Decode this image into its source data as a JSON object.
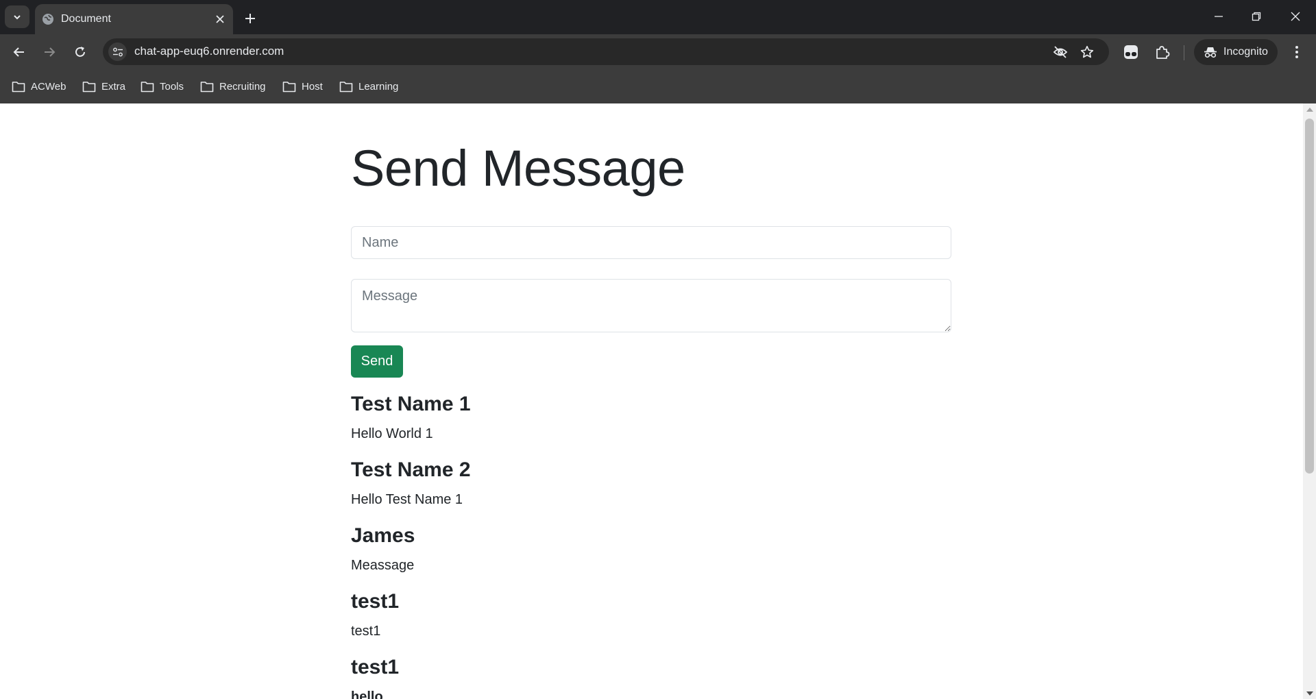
{
  "browser": {
    "tab_title": "Document",
    "url": "chat-app-euq6.onrender.com",
    "incognito_label": "Incognito",
    "bookmarks": [
      "ACWeb",
      "Extra",
      "Tools",
      "Recruiting",
      "Host",
      "Learning"
    ]
  },
  "page": {
    "heading": "Send Message",
    "name_placeholder": "Name",
    "message_placeholder": "Message",
    "send_label": "Send",
    "messages": [
      {
        "name": "Test Name 1",
        "text": "Hello World 1"
      },
      {
        "name": "Test Name 2",
        "text": "Hello Test Name 1"
      },
      {
        "name": "James",
        "text": "Meassage"
      },
      {
        "name": "test1",
        "text": "test1"
      },
      {
        "name": "test1",
        "text": "hello"
      }
    ]
  },
  "colors": {
    "send_button": "#198754",
    "chrome_dark": "#202124",
    "chrome_toolbar": "#3c3c3c"
  }
}
